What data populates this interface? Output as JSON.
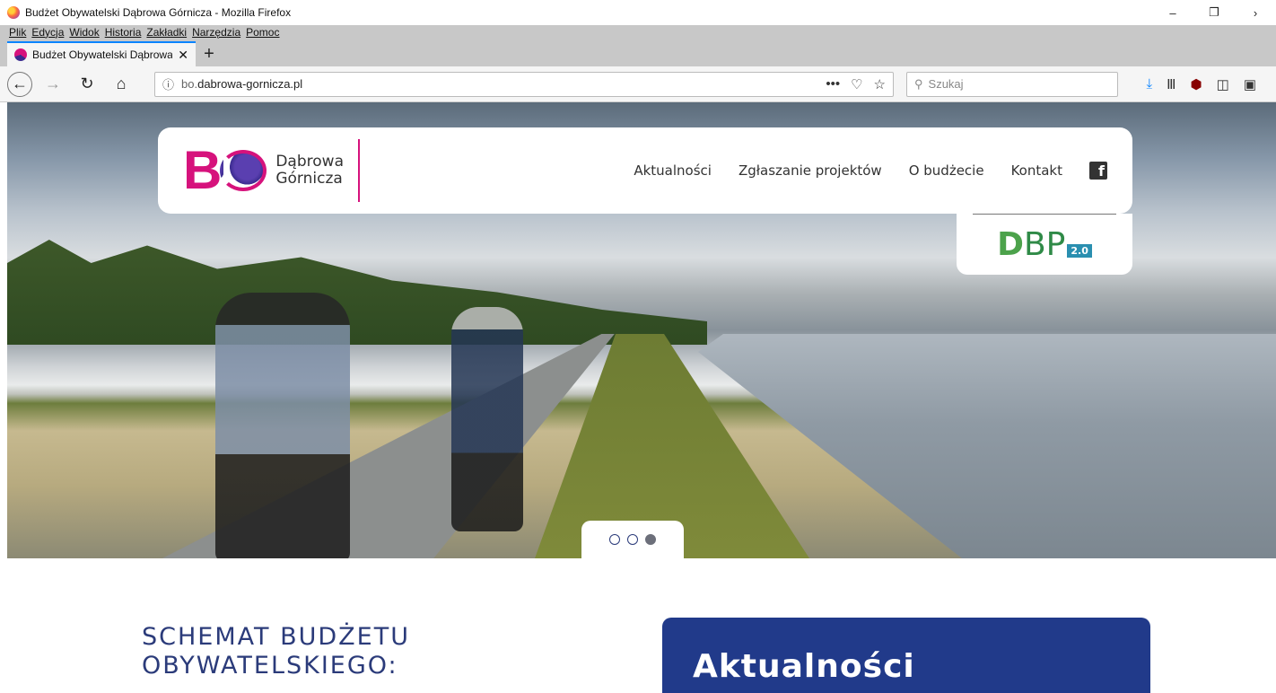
{
  "window": {
    "title": "Budżet Obywatelski Dąbrowa Górnicza - Mozilla Firefox",
    "controls": {
      "minimize": "–",
      "maximize": "❐",
      "more": "›"
    }
  },
  "menubar": [
    "Plik",
    "Edycja",
    "Widok",
    "Historia",
    "Zakładki",
    "Narzędzia",
    "Pomoc"
  ],
  "tabs": [
    {
      "title": "Budżet Obywatelski Dąbrowa G",
      "close": "✕"
    }
  ],
  "new_tab": "+",
  "navbar": {
    "url_prefix": "bo.",
    "url_host": "dabrowa-gornicza.pl",
    "search_placeholder": "Szukaj"
  },
  "site": {
    "brand_letter": "B",
    "brand_city_line1": "Dąbrowa",
    "brand_city_line2": "Górnicza",
    "nav": [
      "Aktualności",
      "Zgłaszanie projektów",
      "O budżecie",
      "Kontakt"
    ],
    "facebook_glyph": "f",
    "dbp": {
      "d": "D",
      "bp": "BP",
      "version": "2.0"
    },
    "slider": {
      "count": 3,
      "active_index": 2
    },
    "schemat_line1": "SCHEMAT BUDŻETU",
    "schemat_line2": "OBYWATELSKIEGO:",
    "news_title": "Aktualności"
  },
  "colors": {
    "brand_pink": "#d6127c",
    "brand_navy": "#213a8a",
    "firefox_accent": "#0a84ff",
    "dbp_green": "#4ca24b"
  }
}
